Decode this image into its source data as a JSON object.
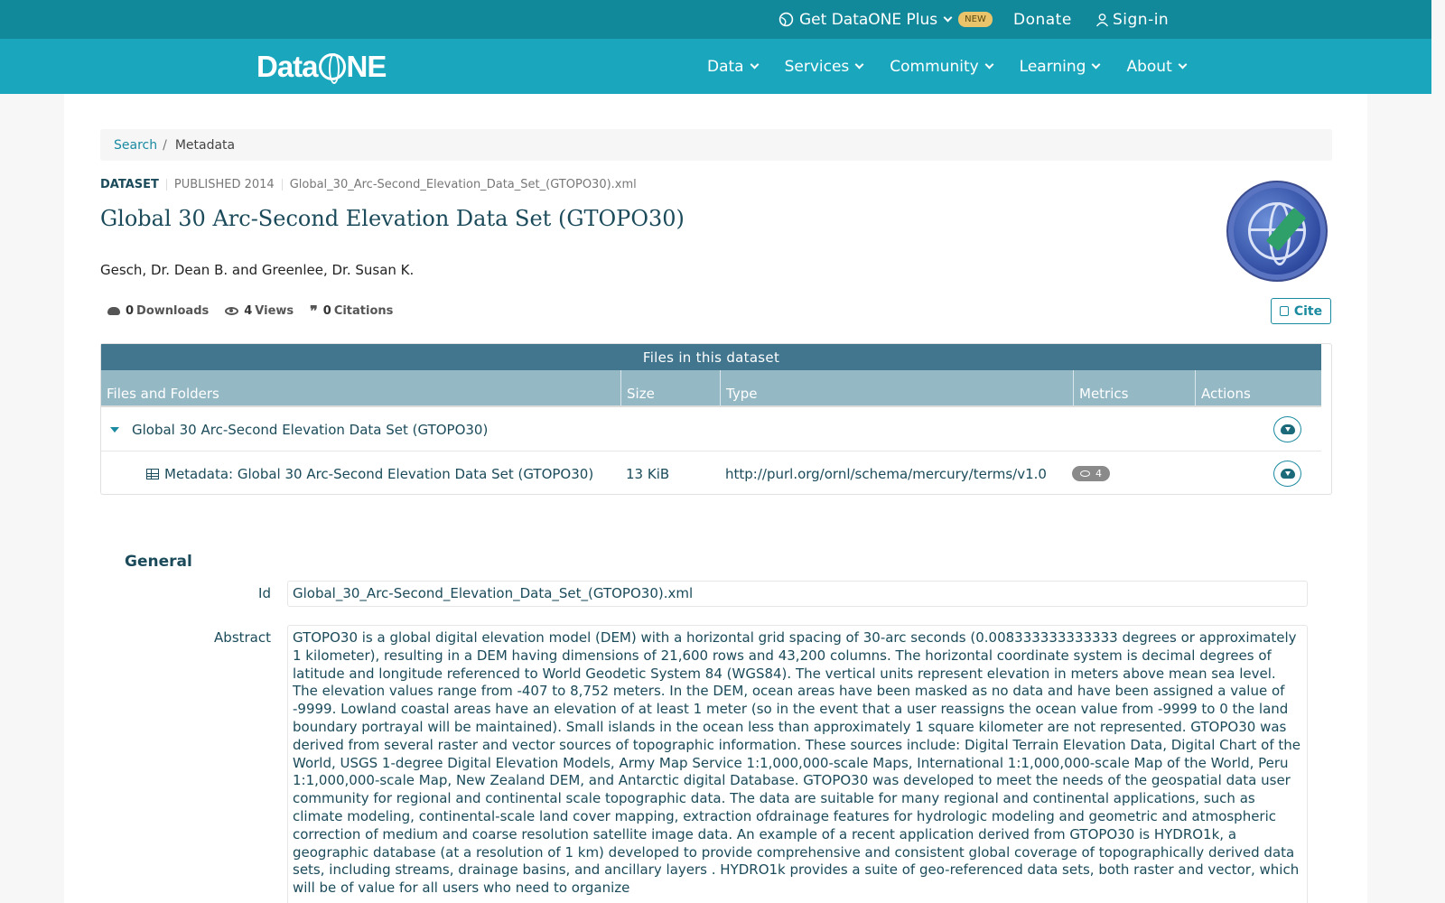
{
  "topbar": {
    "plus_label": "Get DataONE Plus",
    "new_badge": "NEW",
    "donate": "Donate",
    "signin": "Sign-in"
  },
  "nav": {
    "logo": {
      "prefix": "Data",
      "suffix": "NE"
    },
    "items": [
      {
        "label": "Data"
      },
      {
        "label": "Services"
      },
      {
        "label": "Community"
      },
      {
        "label": "Learning"
      },
      {
        "label": "About"
      }
    ]
  },
  "breadcrumb": {
    "search": "Search",
    "separator": "/",
    "current": "Metadata"
  },
  "dataset": {
    "kind": "DATASET",
    "published": "PUBLISHED 2014",
    "filename": "Global_30_Arc-Second_Elevation_Data_Set_(GTOPO30).xml",
    "title": "Global 30 Arc-Second Elevation Data Set (GTOPO30)",
    "authors": "Gesch, Dr. Dean B. and Greenlee, Dr. Susan K."
  },
  "stats": {
    "downloads": {
      "count": "0",
      "label": "Downloads"
    },
    "views": {
      "count": "4",
      "label": "Views"
    },
    "citations": {
      "count": "0",
      "label": "Citations"
    }
  },
  "cite_label": "Cite",
  "files": {
    "heading": "Files in this dataset",
    "columns": [
      "Files and Folders",
      "Size",
      "Type",
      "Metrics",
      "Actions"
    ],
    "package_row": {
      "name": "Global 30 Arc-Second Elevation Data Set (GTOPO30)"
    },
    "file_row": {
      "name": "Metadata: Global 30 Arc-Second Elevation Data Set (GTOPO30)",
      "size": "13 KiB",
      "type": "http://purl.org/ornl/schema/mercury/terms/v1.0",
      "views": "4"
    }
  },
  "general": {
    "heading": "General",
    "id_label": "Id",
    "id_value": "Global_30_Arc-Second_Elevation_Data_Set_(GTOPO30).xml",
    "abstract_label": "Abstract",
    "abstract": "GTOPO30 is a global digital elevation model (DEM) with a horizontal grid spacing of 30-arc seconds (0.008333333333333 degrees or approximately 1 kilometer), resulting in a DEM having dimensions of 21,600 rows and 43,200 columns. The horizontal coordinate system is decimal degrees of latitude and longitude referenced to World Geodetic System 84 (WGS84). The vertical units represent elevation in meters above mean sea level. The elevation values range from -407 to 8,752 meters. In the DEM, ocean areas have been masked as no data and have been assigned a value of -9999. Lowland coastal areas have an elevation of at least 1 meter (so in the event that a user reassigns the ocean value from -9999 to 0 the land boundary portrayal will be maintained). Small islands in the ocean less than approximately 1 square kilometer are not represented. GTOPO30 was derived from several raster and vector sources of topographic information. These sources include: Digital Terrain Elevation Data, Digital Chart of the World, USGS 1-degree Digital Elevation Models, Army Map Service 1:1,000,000-scale Maps, International 1:1,000,000-scale Map of the World, Peru 1:1,000,000-scale Map, New Zealand DEM, and Antarctic digital Database. GTOPO30 was developed to meet the needs of the geospatial data user community for regional and continental scale topographic data. The data are suitable for many regional and continental applications, such as climate modeling, continental-scale land cover mapping, extraction ofdrainage features for hydrologic modeling and geometric and atmospheric correction of medium and coarse resolution satellite image data. An example of a recent application derived from GTOPO30 is HYDRO1k, a geographic database (at a resolution of 1 km) developed to provide comprehensive and consistent global coverage of topographically derived data sets, including streams, drainage basins, and ancillary layers . HYDRO1k provides a suite of geo-referenced data sets, both raster and vector, which will be of value for all users who need to organize"
  },
  "colors": {
    "topbar": "#12899b",
    "navbar": "#1aa7bd",
    "accent": "#1a8aa0",
    "heading": "#1b4b5a"
  }
}
